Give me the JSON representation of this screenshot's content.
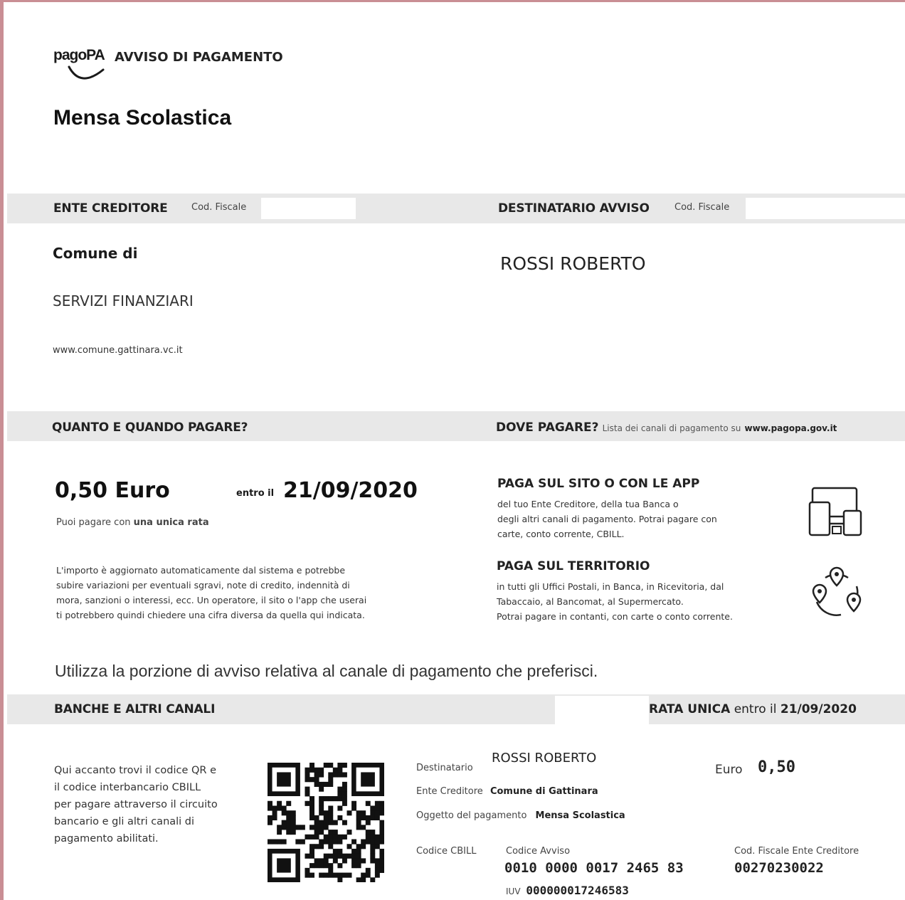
{
  "header": {
    "logo_text": "pagoPA",
    "notice_type": "AVVISO DI PAGAMENTO",
    "subject": "Mensa Scolastica"
  },
  "creditor": {
    "heading": "ENTE CREDITORE",
    "cf_label": "Cod. Fiscale",
    "name": "Comune di",
    "department": "SERVIZI FINANZIARI",
    "website": "www.comune.gattinara.vc.it"
  },
  "recipient": {
    "heading": "DESTINATARIO AVVISO",
    "cf_label": "Cod. Fiscale",
    "name": "ROSSI ROBERTO"
  },
  "amount_section": {
    "heading": "QUANTO E QUANDO PAGARE?",
    "amount": "0,50 Euro",
    "due_prefix": "entro il",
    "due_date": "21/09/2020",
    "installment_prefix": "Puoi pagare con",
    "installment_bold": "una unica rata",
    "note_lines": [
      "L'importo è aggiornato automaticamente dal sistema e potrebbe",
      "subire variazioni per eventuali sgravi, note di credito, indennità di",
      "mora, sanzioni o interessi, ecc.  Un operatore, il sito o l'app che userai",
      "ti potrebbero quindi chiedere una cifra diversa da quella qui indicata."
    ]
  },
  "where_section": {
    "heading": "DOVE PAGARE?",
    "subtext": "Lista dei canali di pagamento su",
    "url": "www.pagopa.gov.it",
    "online_title": "PAGA SUL SITO O CON LE APP",
    "online_lines": [
      "del tuo Ente Creditore, della tua Banca o",
      "degli altri canali di pagamento. Potrai pagare con",
      "carte, conto corrente, CBILL."
    ],
    "territory_title": "PAGA SUL TERRITORIO",
    "territory_lines": [
      "in tutti gli Uffici Postali, in Banca, in Ricevitoria, dal",
      "Tabaccaio, al Bancomat, al Supermercato.",
      "Potrai pagare in contanti, con carte o conto corrente."
    ]
  },
  "instruction": "Utilizza la porzione di avviso relativa al canale di pagamento che preferisci.",
  "bank_section": {
    "heading": "BANCHE E ALTRI CANALI",
    "rata_bold": "RATA UNICA",
    "rata_rest": "entro il",
    "rata_date": "21/09/2020",
    "desc_lines": [
      "Qui accanto trovi il codice QR e",
      "il codice interbancario CBILL",
      "per pagare attraverso il circuito",
      "bancario e gli altri canali di",
      "pagamento abilitati."
    ],
    "recipient_label": "Destinatario",
    "recipient_value": "ROSSI ROBERTO",
    "euro_label": "Euro",
    "euro_value": "0,50",
    "creditor_label": "Ente Creditore",
    "creditor_value": "Comune di Gattinara",
    "object_label": "Oggetto del pagamento",
    "object_value": "Mensa Scolastica",
    "cbill_label": "Codice CBILL",
    "notice_code_label": "Codice Avviso",
    "notice_code_value": "0010 0000 0017 2465 83",
    "iuv_label": "IUV",
    "iuv_value": "000000017246583",
    "creditor_cf_label": "Cod. Fiscale Ente Creditore",
    "creditor_cf_value": "00270230022"
  }
}
